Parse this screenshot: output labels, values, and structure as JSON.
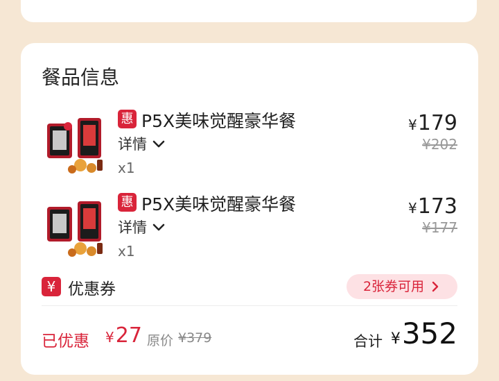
{
  "section_title": "餐品信息",
  "items": [
    {
      "badge": "惠",
      "name": "P5X美味觉醒豪华餐",
      "detail_label": "详情",
      "quantity": "x1",
      "currency": "¥",
      "price": "179",
      "original_price": "¥202"
    },
    {
      "badge": "惠",
      "name": "P5X美味觉醒豪华餐",
      "detail_label": "详情",
      "quantity": "x1",
      "currency": "¥",
      "price": "173",
      "original_price": "¥177"
    }
  ],
  "coupon": {
    "icon_glyph": "¥",
    "label": "优惠券",
    "available": "2张券可用"
  },
  "summary": {
    "saved_label": "已优惠",
    "saved_currency": "¥",
    "saved_amount": "27",
    "original_label": "原价",
    "original_total": "¥379",
    "total_label": "合计",
    "total_currency": "¥",
    "total_amount": "352"
  },
  "colors": {
    "accent": "#d9243a",
    "page_bg": "#f6e7d4",
    "pill_bg": "#fde1e4"
  }
}
